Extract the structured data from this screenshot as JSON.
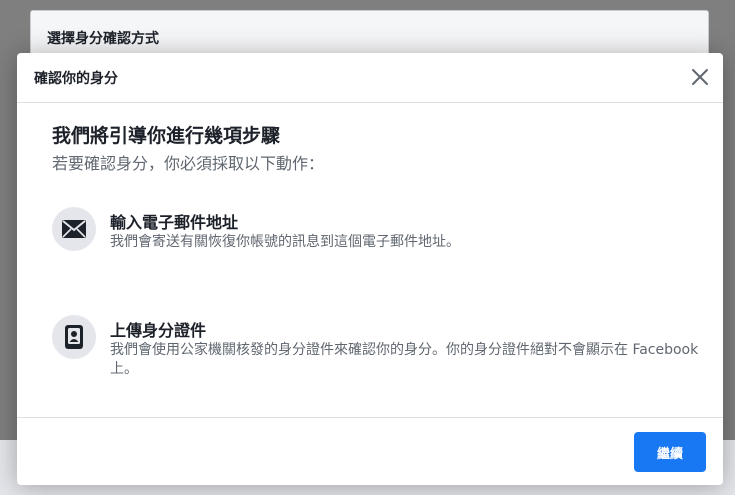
{
  "background": {
    "panel_title": "選擇身分確認方式"
  },
  "dialog": {
    "title": "確認你的身分",
    "heading": "我們將引導你進行幾項步驟",
    "subheading": "若要確認身分，你必須採取以下動作：",
    "steps": [
      {
        "icon": "envelope-icon",
        "title": "輸入電子郵件地址",
        "description": "我們會寄送有關恢復你帳號的訊息到這個電子郵件地址。"
      },
      {
        "icon": "id-card-icon",
        "title": "上傳身分證件",
        "description": "我們會使用公家機關核發的身分證件來確認你的身分。你的身分證件絕對不會顯示在 Facebook 上。"
      }
    ],
    "continue_label": "繼續"
  },
  "colors": {
    "primary": "#1877f2",
    "text": "#1d2129",
    "secondary_text": "#606770"
  }
}
